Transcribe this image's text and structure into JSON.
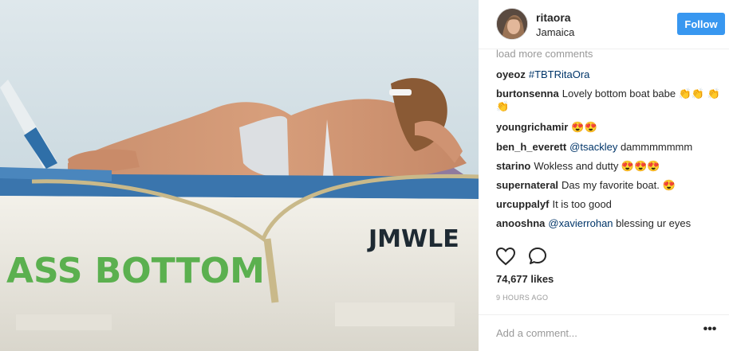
{
  "post": {
    "boat_text_left": "ASS BOTTOM",
    "boat_text_right": "JMWLE",
    "colors": {
      "follow": "#3897f0",
      "mention": "#003569",
      "muted": "#999999"
    }
  },
  "header": {
    "username": "ritaora",
    "location": "Jamaica",
    "follow_label": "Follow"
  },
  "comments": {
    "load_more": "load more comments",
    "items": [
      {
        "user": "oyeoz",
        "mention": "#TBTRitaOra",
        "text": ""
      },
      {
        "user": "burtonsenna",
        "mention": "",
        "text": "Lovely bottom boat babe 👏👏 👏👏"
      },
      {
        "user": "youngrichamir",
        "mention": "",
        "text": "😍😍"
      },
      {
        "user": "ben_h_everett",
        "mention": "@tsackley",
        "text": "dammmmmmm"
      },
      {
        "user": "starino",
        "mention": "",
        "text": "Wokless and dutty 😍😍😍"
      },
      {
        "user": "supernateral",
        "mention": "",
        "text": "Das my favorite boat. 😍"
      },
      {
        "user": "urcuppalyf",
        "mention": "",
        "text": "It is too good"
      },
      {
        "user": "anooshna",
        "mention": "@xavierrohan",
        "text": "blessing ur eyes"
      }
    ]
  },
  "actions": {
    "like_icon": "heart-outline-icon",
    "comment_icon": "comment-bubble-icon",
    "likes_text": "74,677 likes",
    "timestamp": "9 HOURS AGO"
  },
  "add_comment": {
    "placeholder": "Add a comment...",
    "more_icon": "ellipsis-icon",
    "more_glyph": "•••"
  }
}
